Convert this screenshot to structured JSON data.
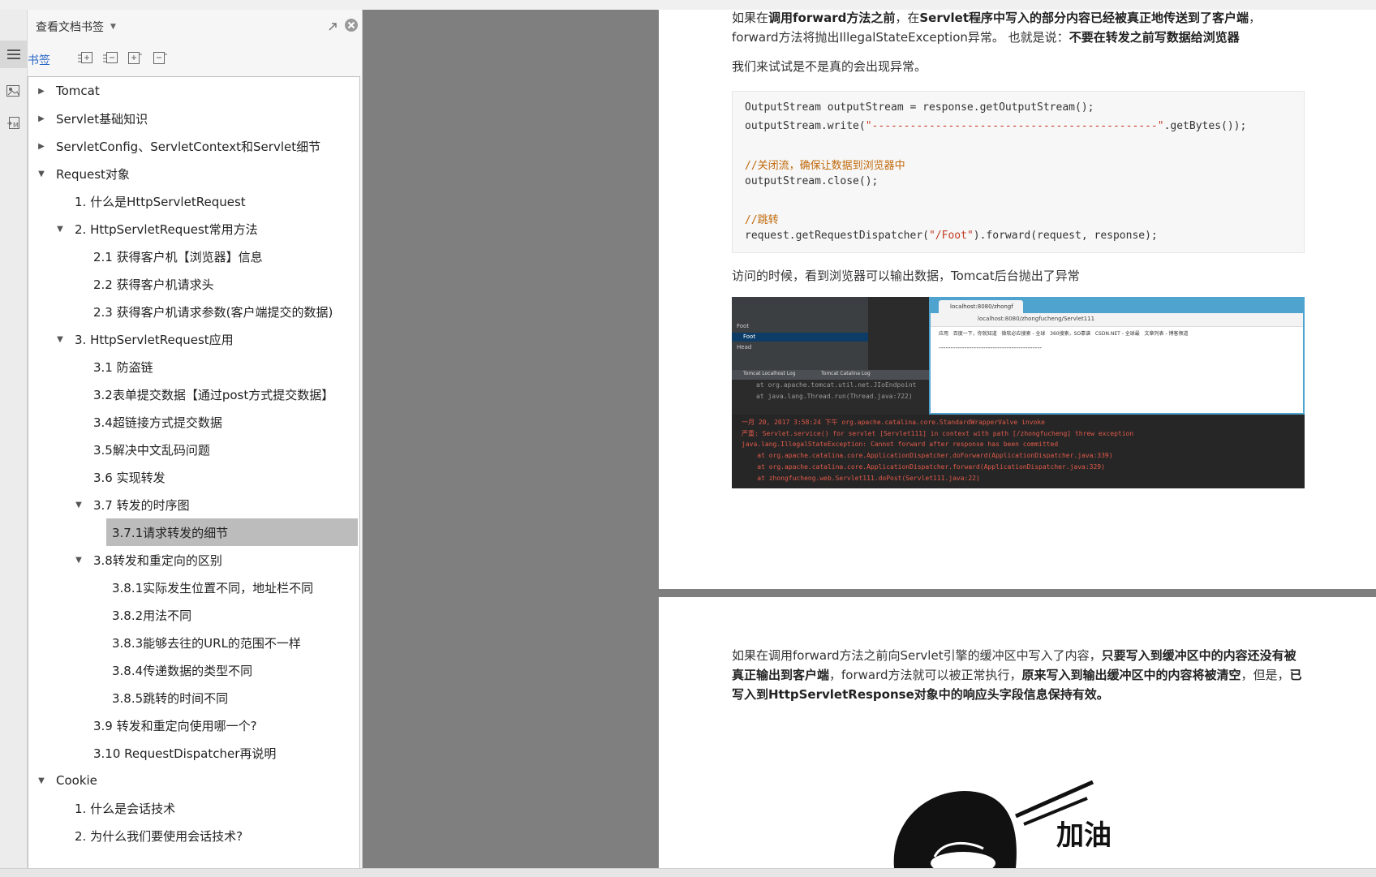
{
  "panel": {
    "title": "查看文档书签",
    "bookmark_label": "书签"
  },
  "tree": [
    {
      "label": "Tomcat",
      "state": "collapsed",
      "level": 0
    },
    {
      "label": "Servlet基础知识",
      "state": "collapsed",
      "level": 0
    },
    {
      "label": "ServletConfig、ServletContext和Servlet细节",
      "state": "collapsed",
      "level": 0
    },
    {
      "label": "Request对象",
      "state": "expanded",
      "level": 0
    },
    {
      "label": "1. 什么是HttpServletRequest",
      "state": "leaf",
      "level": 1
    },
    {
      "label": "2. HttpServletRequest常用方法",
      "state": "expanded",
      "level": 1
    },
    {
      "label": "2.1 获得客户机【浏览器】信息",
      "state": "leaf",
      "level": 2
    },
    {
      "label": "2.2 获得客户机请求头",
      "state": "leaf",
      "level": 2
    },
    {
      "label": "2.3 获得客户机请求参数(客户端提交的数据)",
      "state": "leaf",
      "level": 2
    },
    {
      "label": "3. HttpServletRequest应用",
      "state": "expanded",
      "level": 1
    },
    {
      "label": "3.1 防盗链",
      "state": "leaf",
      "level": 2
    },
    {
      "label": "3.2表单提交数据【通过post方式提交数据】",
      "state": "leaf",
      "level": 2
    },
    {
      "label": "3.4超链接方式提交数据",
      "state": "leaf",
      "level": 2
    },
    {
      "label": "3.5解决中文乱码问题",
      "state": "leaf",
      "level": 2
    },
    {
      "label": "3.6 实现转发",
      "state": "leaf",
      "level": 2
    },
    {
      "label": "3.7 转发的时序图",
      "state": "expanded",
      "level": 2
    },
    {
      "label": "3.7.1请求转发的细节",
      "state": "leaf",
      "level": 3,
      "selected": true
    },
    {
      "label": "3.8转发和重定向的区别",
      "state": "expanded",
      "level": 2
    },
    {
      "label": "3.8.1实际发生位置不同，地址栏不同",
      "state": "leaf",
      "level": 3
    },
    {
      "label": "3.8.2用法不同",
      "state": "leaf",
      "level": 3
    },
    {
      "label": "3.8.3能够去往的URL的范围不一样",
      "state": "leaf",
      "level": 3
    },
    {
      "label": "3.8.4传递数据的类型不同",
      "state": "leaf",
      "level": 3
    },
    {
      "label": "3.8.5跳转的时间不同",
      "state": "leaf",
      "level": 3
    },
    {
      "label": "3.9 转发和重定向使用哪一个?",
      "state": "leaf",
      "level": 2
    },
    {
      "label": "3.10 RequestDispatcher再说明",
      "state": "leaf",
      "level": 2
    },
    {
      "label": "Cookie",
      "state": "expanded",
      "level": 0
    },
    {
      "label": "1. 什么是会话技术",
      "state": "leaf",
      "level": 1
    },
    {
      "label": "2. 为什么我们要使用会话技术?",
      "state": "leaf",
      "level": 1
    }
  ],
  "doc": {
    "p1_pre": "如果在",
    "p1_b1": "调用forward方法之前",
    "p1_mid": "，在",
    "p1_b2": "Servlet程序中写入的部分内容已经被真正地传送到了客户端",
    "p1_post": "，",
    "p1_line2": "forward方法将抛出IllegalStateException异常。 也就是说：",
    "p1_b3": "不要在转发之前写数据给浏览器",
    "p2": "我们来试试是不是真的会出现异常。",
    "code": {
      "l1": "OutputStream outputStream = response.getOutputStream();",
      "l2a": "outputStream.write(",
      "l2s": "\"---------------------------------------------\"",
      "l2b": ".getBytes());",
      "l3": "//关闭流，确保让数据到浏览器中",
      "l4": "outputStream.close();",
      "l5": "//跳转",
      "l6a": "request.getRequestDispatcher(",
      "l6s": "\"/Foot\"",
      "l6b": ").forward(request, response);"
    },
    "p3": "访问的时候，看到浏览器可以输出数据，Tomcat后台抛出了异常",
    "screenshot": {
      "tab": "localhost:8080/zhongf",
      "url": "localhost:8080/zhongfucheng/Servlet111",
      "bookmarks": "应用   百度一下，你就知道   微软必应搜索 - 全球   360搜索，SO靠谱   CSDN.NET - 全球最   文章列表 - 博客频道",
      "dashes": "--------------------------------------------",
      "ide_item1": "Foot",
      "ide_item2": "Foot",
      "ide_item3": "Head",
      "logtab1": "Tomcat Localhost Log",
      "logtab2": "Tomcat Catalina Log",
      "trace1": "at org.apache.tomcat.util.net.JIoEndpoint",
      "trace2": "at java.lang.Thread.run(Thread.java:722)",
      "c1": "一月 20, 2017 3:58:24 下午 org.apache.catalina.core.StandardWrapperValve invoke",
      "c2": "严重: Servlet.service() for servlet [Servlet111] in context with path [/zhongfucheng] threw exception",
      "c3": "java.lang.IllegalStateException: Cannot forward after response has been committed",
      "c4": "    at org.apache.catalina.core.ApplicationDispatcher.doForward(ApplicationDispatcher.java:339)",
      "c5": "    at org.apache.catalina.core.ApplicationDispatcher.forward(ApplicationDispatcher.java:329)",
      "c6": "    at zhongfucheng.web.Servlet111.doPost(Servlet111.java:22)"
    },
    "p4_pre": "如果在调用forward方法之前向Servlet引擎的缓冲区中写入了内容，",
    "p4_b1": "只要写入到缓冲区中的内容还没有被真正输出到客户端",
    "p4_mid": "，forward方法就可以被正常执行，",
    "p4_b2": "原来写入到输出缓冲区中的内容将被清空",
    "p4_mid2": "，但是，",
    "p4_b3": "已写入到HttpServletResponse对象中的响应头字段信息保持有效。",
    "cartoon_text": "加油"
  }
}
